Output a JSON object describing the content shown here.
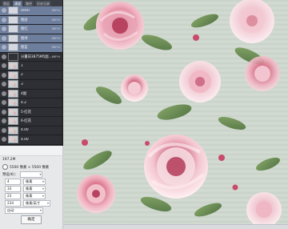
{
  "layers_panel": {
    "tabs": [
      "图层",
      "通道",
      "路径",
      "历史记录"
    ],
    "active_tab": 1,
    "rows": [
      {
        "name": "DRHI",
        "meta": "68FHI",
        "style": "band",
        "thumb": "light"
      },
      {
        "name": "图层",
        "meta": "68FHI",
        "style": "band",
        "thumb": "light"
      },
      {
        "name": "图红",
        "meta": "68FHI",
        "style": "band",
        "thumb": "light"
      },
      {
        "name": "图绿",
        "meta": "68FHI",
        "style": "band",
        "thumb": "light"
      },
      {
        "name": "图蓝",
        "meta": "68FHI",
        "style": "band",
        "thumb": "light"
      },
      {
        "name": "分量日3875M5副...",
        "meta": "68FHI",
        "style": "dark",
        "thumb": "dark"
      },
      {
        "name": "1",
        "meta": "",
        "style": "dark",
        "thumb": "pattern"
      },
      {
        "name": "2",
        "meta": "",
        "style": "dark",
        "thumb": "pattern"
      },
      {
        "name": "3",
        "meta": "",
        "style": "dark",
        "thumb": "pattern"
      },
      {
        "name": "4副",
        "meta": "",
        "style": "dark",
        "thumb": "pattern"
      },
      {
        "name": "4.2",
        "meta": "",
        "style": "dark",
        "thumb": "pattern"
      },
      {
        "name": "5-红花",
        "meta": "",
        "style": "dark",
        "thumb": "pattern"
      },
      {
        "name": "6-红花",
        "meta": "",
        "style": "dark",
        "thumb": "pattern"
      },
      {
        "name": "4.00",
        "meta": "",
        "style": "dark",
        "thumb": "pattern"
      },
      {
        "name": "4.00",
        "meta": "",
        "style": "dark",
        "thumb": "pattern"
      }
    ]
  },
  "dialog": {
    "size_value": "197.2M",
    "dimension_text": "5500 像素 × 5500 像素",
    "preset_label": "预设(K)：",
    "rows": [
      {
        "value": "4",
        "unit": "像素"
      },
      {
        "value": "33",
        "unit": "像素"
      },
      {
        "value": "23",
        "unit": "像素"
      },
      {
        "value": "234",
        "unit": "像素/英寸"
      },
      {
        "value": "自动",
        "unit": ""
      }
    ],
    "ok_label": "确定"
  }
}
